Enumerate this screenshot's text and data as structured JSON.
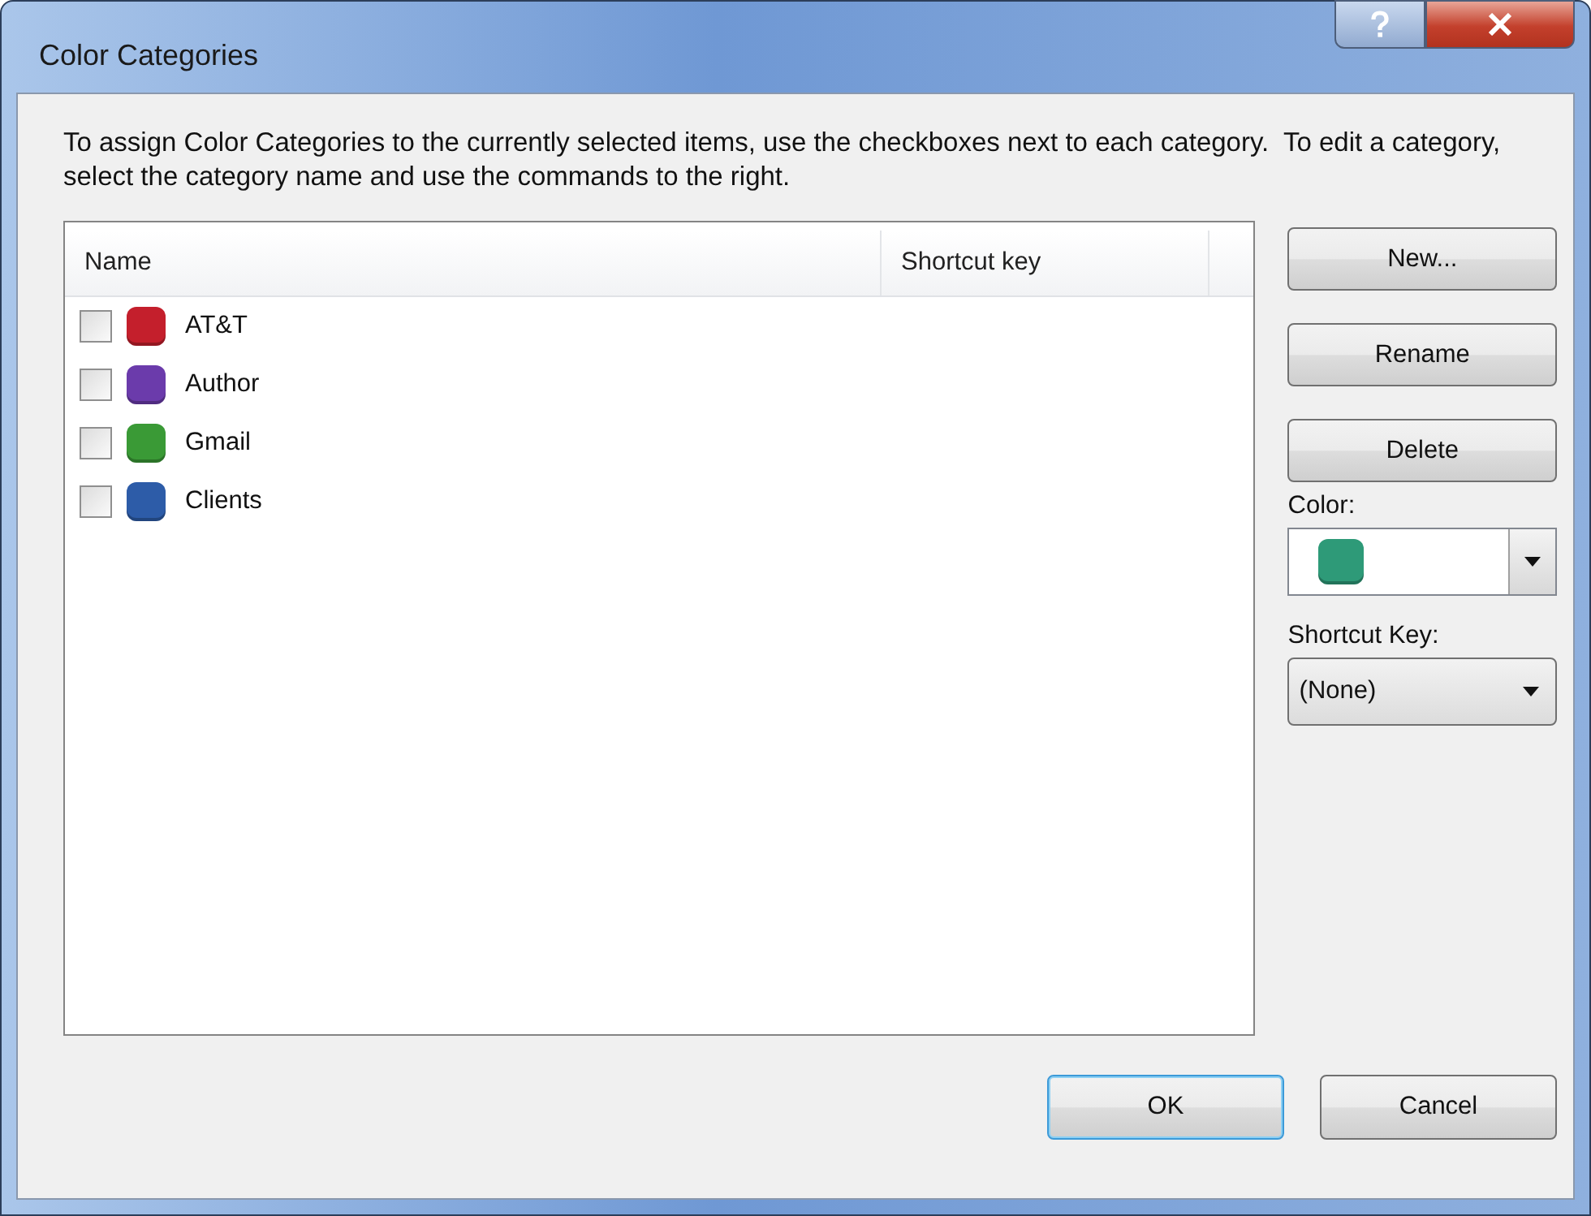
{
  "window": {
    "title": "Color Categories"
  },
  "instructions": "To assign Color Categories to the currently selected items, use the checkboxes next to each category.  To edit a category, select the category name and use the commands to the right.",
  "list": {
    "columns": [
      "Name",
      "Shortcut key"
    ],
    "rows": [
      {
        "name": "AT&T",
        "color": "#c41f2c",
        "checked": false
      },
      {
        "name": "Author",
        "color": "#6b3bab",
        "checked": false
      },
      {
        "name": "Gmail",
        "color": "#3a9a36",
        "checked": false
      },
      {
        "name": "Clients",
        "color": "#2d5ca8",
        "checked": false
      }
    ]
  },
  "commands": [
    "New...",
    "Rename",
    "Delete"
  ],
  "color_field": {
    "label": "Color:",
    "color": "#2e9a78"
  },
  "shortcut_field": {
    "label": "Shortcut Key:",
    "value": "(None)"
  },
  "dialog_buttons": [
    {
      "label": "OK",
      "default": true
    },
    {
      "label": "Cancel",
      "default": false
    }
  ]
}
